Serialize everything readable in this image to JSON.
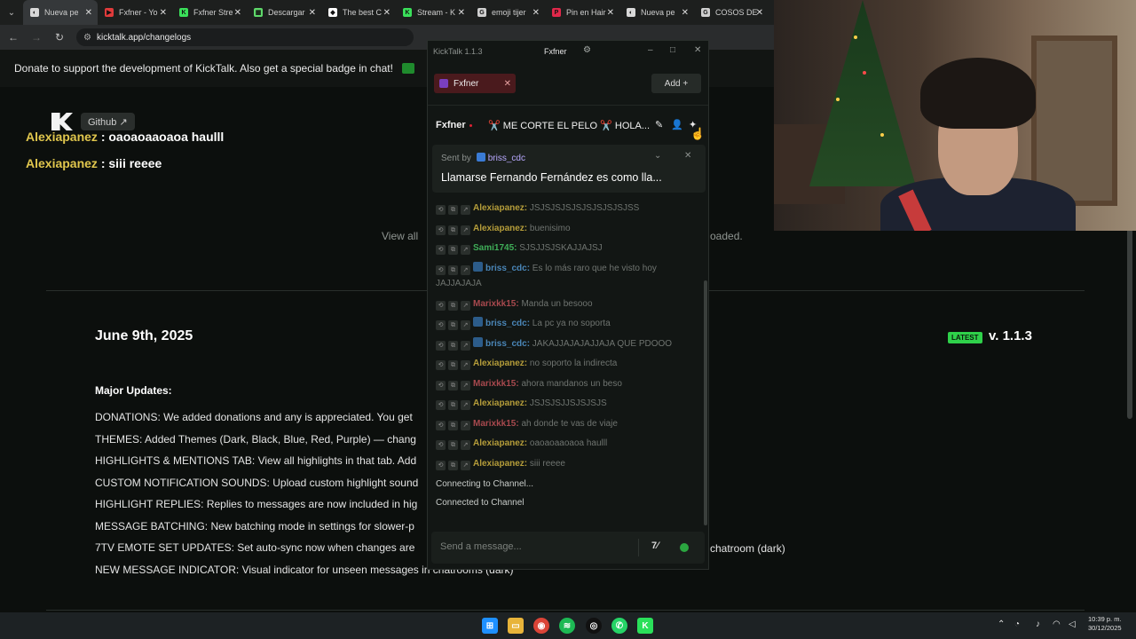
{
  "browser": {
    "tabs": [
      {
        "label": "Nueva pe",
        "icon_color": "#d8d8d8",
        "glyph": "◐"
      },
      {
        "label": "Fxfner - Yo",
        "icon_color": "#e03b3b",
        "glyph": "▶"
      },
      {
        "label": "Fxfner Stre",
        "icon_color": "#3ae05a",
        "glyph": "K"
      },
      {
        "label": "Descargar",
        "icon_color": "#5ed86a",
        "glyph": "▦"
      },
      {
        "label": "The best C",
        "icon_color": "#ffffff",
        "glyph": "◆"
      },
      {
        "label": "Stream - K",
        "icon_color": "#3ae05a",
        "glyph": "K"
      },
      {
        "label": "emoji tijer",
        "icon_color": "#cfcfcf",
        "glyph": "G"
      },
      {
        "label": "Pin en Hair",
        "icon_color": "#e0284a",
        "glyph": "P"
      },
      {
        "label": "Nueva pe",
        "icon_color": "#d8d8d8",
        "glyph": "◐"
      },
      {
        "label": "COSOS DE",
        "icon_color": "#cfcfcf",
        "glyph": "G"
      }
    ],
    "url": "kicktalk.app/changelogs"
  },
  "page": {
    "donate_text": "Donate to support the development of KickTalk. Also get a special badge in chat!",
    "github_label": "Github ↗",
    "view_all_prefix": "View all",
    "view_all_suffix": "oaded.",
    "release_date": "June 9th, 2025",
    "latest_badge": "LATEST",
    "version": "v. 1.1.3",
    "major_updates": "Major Updates:",
    "updates": [
      "DONATIONS: We added donations and any is appreciated. You get",
      "THEMES: Added Themes (Dark, Black, Blue, Red, Purple) — chang",
      "HIGHLIGHTS & MENTIONS TAB: View all highlights in that tab. Add",
      "CUSTOM NOTIFICATION SOUNDS: Upload custom highlight sound",
      "HIGHLIGHT REPLIES: Replies to messages are now included in hig",
      "MESSAGE BATCHING: New batching mode in settings for slower-p",
      "7TV EMOTE SET UPDATES: Set auto-sync now when changes are",
      "NEW MESSAGE INDICATOR: Visual indicator for unseen messages in chatrooms (dark)"
    ],
    "right_suffix": "chatroom (dark)"
  },
  "overlay_chat": [
    {
      "user": "Alexiapanez",
      "text": " : oaoaoaaoaoa haulll"
    },
    {
      "user": "Alexiapanez",
      "text": " : siii reeee"
    }
  ],
  "kicktalk": {
    "app_title": "KickTalk 1.1.3",
    "username": "Fxfner",
    "channel_tab": "Fxfner",
    "add_label": "Add +",
    "channel_name": "Fxfner",
    "stream_title": "✂️ ME CORTE EL PELO ✂️ HOLA...",
    "pinned": {
      "sent_by_label": "Sent by ",
      "sender": "briss_cdc",
      "message": "Llamarse Fernando Fernández es como lla..."
    },
    "messages": [
      {
        "user": "Alexiapanez:",
        "text": " JSJSJSJSJSJSJSJSJSJSS",
        "color": "#b59d3a",
        "badge": false
      },
      {
        "user": "Alexiapanez:",
        "text": " buenisimo",
        "color": "#b59d3a",
        "badge": false
      },
      {
        "user": "Sami1745:",
        "text": " SJSJJSJSKAJJAJSJ",
        "color": "#3fae58",
        "badge": false
      },
      {
        "user": "briss_cdc:",
        "text": " Es lo más raro que he visto hoy JAJJAJAJA",
        "color": "#4a86b8",
        "badge": true
      },
      {
        "user": "Marixkk15:",
        "text": " Manda un besooo",
        "color": "#a8494e",
        "badge": false
      },
      {
        "user": "briss_cdc:",
        "text": " La pc ya no soporta",
        "color": "#4a86b8",
        "badge": true
      },
      {
        "user": "briss_cdc:",
        "text": " JAKAJJAJAJAJJAJA QUE PDOOO",
        "color": "#4a86b8",
        "badge": true
      },
      {
        "user": "Alexiapanez:",
        "text": " no soporto la indirecta",
        "color": "#b59d3a",
        "badge": false
      },
      {
        "user": "Marixkk15:",
        "text": " ahora mandanos un beso",
        "color": "#a8494e",
        "badge": false
      },
      {
        "user": "Alexiapanez:",
        "text": " JSJSJSJJSJSJSJS",
        "color": "#b59d3a",
        "badge": false
      },
      {
        "user": "Marixkk15:",
        "text": " ah donde te vas de viaje",
        "color": "#a8494e",
        "badge": false
      },
      {
        "user": "Alexiapanez:",
        "text": " oaoaoaaoaoa haulll",
        "color": "#b59d3a",
        "badge": false
      },
      {
        "user": "Alexiapanez:",
        "text": " siii reeee",
        "color": "#b59d3a",
        "badge": false
      }
    ],
    "system": [
      "Connecting to Channel...",
      "Connected to Channel"
    ],
    "input_placeholder": "Send a message..."
  },
  "taskbar": {
    "clock_time": "10:39 p. m.",
    "clock_date": "30/12/2025"
  }
}
